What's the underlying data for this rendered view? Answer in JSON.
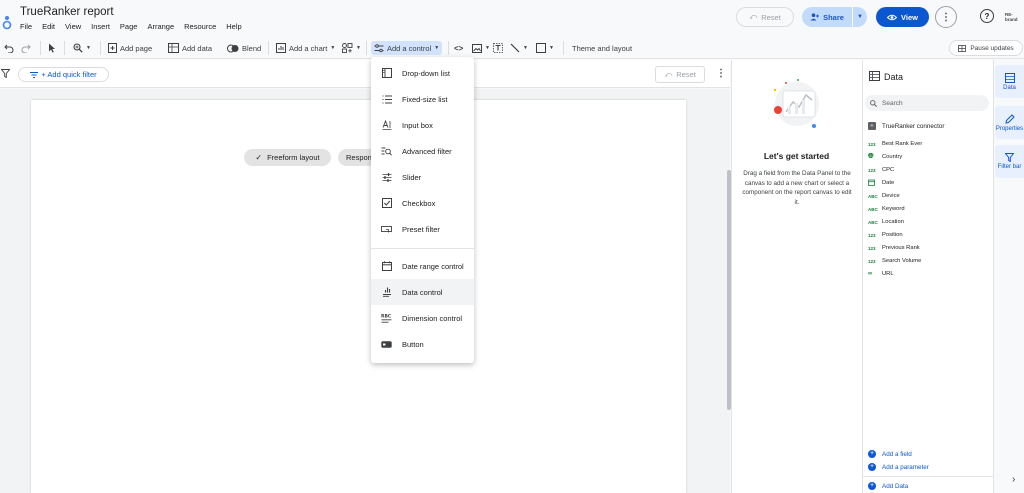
{
  "app": {
    "title": "TrueRanker report",
    "menu": [
      "File",
      "Edit",
      "View",
      "Insert",
      "Page",
      "Arrange",
      "Resource",
      "Help"
    ]
  },
  "header": {
    "reset_label": "Reset",
    "share_label": "Share",
    "view_label": "View",
    "account_logo_text": "RE-brand"
  },
  "toolbar": {
    "add_page": "Add page",
    "add_data": "Add data",
    "blend": "Blend",
    "add_chart": "Add a chart",
    "add_control": "Add a control",
    "theme_layout": "Theme and layout",
    "pause_updates": "Pause updates"
  },
  "filter_bar": {
    "quick_filter": "+ Add quick filter",
    "reset_label": "Reset"
  },
  "canvas": {
    "freeform_chip": "Freeform layout",
    "responsive_chip": "Responsive layout"
  },
  "control_menu": {
    "items": [
      {
        "label": "Drop-down list",
        "icon": "dropdown-list-icon"
      },
      {
        "label": "Fixed-size list",
        "icon": "fixed-list-icon"
      },
      {
        "label": "Input box",
        "icon": "input-box-icon"
      },
      {
        "label": "Advanced filter",
        "icon": "advanced-filter-icon"
      },
      {
        "label": "Slider",
        "icon": "slider-icon"
      },
      {
        "label": "Checkbox",
        "icon": "checkbox-icon"
      },
      {
        "label": "Preset filter",
        "icon": "preset-filter-icon"
      },
      {
        "label": "Date range control",
        "icon": "calendar-icon"
      },
      {
        "label": "Data control",
        "icon": "data-control-icon"
      },
      {
        "label": "Dimension control",
        "icon": "dimension-control-icon"
      },
      {
        "label": "Button",
        "icon": "button-icon"
      }
    ],
    "hovered": "Data control"
  },
  "get_started": {
    "title": "Let's get started",
    "text": "Drag a field from the Data Panel to the canvas to add a new chart or select a component on the report canvas to edit it."
  },
  "data_panel": {
    "title": "Data",
    "search_placeholder": "Search",
    "connector": "TrueRanker connector",
    "fields": [
      {
        "type": "123",
        "name": "Best Rank Ever"
      },
      {
        "type": "globe",
        "name": "Country"
      },
      {
        "type": "123",
        "name": "CPC"
      },
      {
        "type": "date",
        "name": "Date"
      },
      {
        "type": "ABC",
        "name": "Device"
      },
      {
        "type": "ABC",
        "name": "Keyword"
      },
      {
        "type": "ABC",
        "name": "Location"
      },
      {
        "type": "123",
        "name": "Position"
      },
      {
        "type": "123",
        "name": "Previous Rank"
      },
      {
        "type": "123",
        "name": "Search Volume"
      },
      {
        "type": "link",
        "name": "URL"
      }
    ],
    "add_field": "Add a field",
    "add_parameter": "Add a parameter",
    "add_data": "Add Data"
  },
  "right_rail": {
    "tabs": [
      "Data",
      "Properties",
      "Filter bar"
    ]
  },
  "colors": {
    "accent": "#0b57d0",
    "share_bg": "#c2dbfb",
    "field_type_green": "#188038"
  }
}
